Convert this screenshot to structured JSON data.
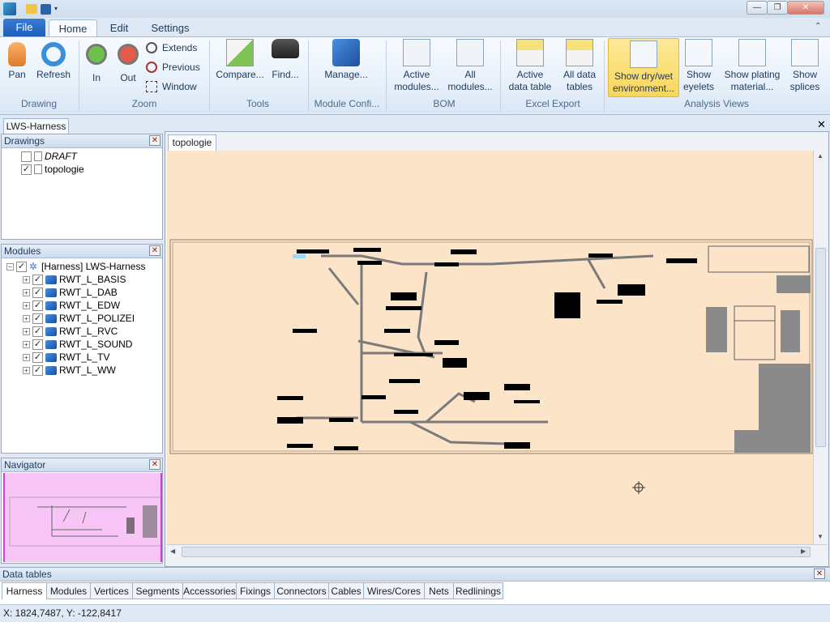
{
  "ribbon": {
    "file": "File",
    "tabs": [
      "Home",
      "Edit",
      "Settings"
    ],
    "drawing": {
      "pan": "Pan",
      "refresh": "Refresh",
      "label": "Drawing"
    },
    "zoom": {
      "in": "In",
      "out": "Out",
      "extends": "Extends",
      "previous": "Previous",
      "window": "Window",
      "label": "Zoom"
    },
    "tools": {
      "compare": "Compare...",
      "find": "Find...",
      "label": "Tools"
    },
    "module": {
      "manage": "Manage...",
      "label": "Module Confi..."
    },
    "bom": {
      "active1": "Active",
      "active2": "modules...",
      "all1": "All",
      "all2": "modules...",
      "label": "BOM"
    },
    "excel": {
      "adt1": "Active",
      "adt2": "data table",
      "all1": "All data",
      "all2": "tables",
      "label": "Excel Export"
    },
    "analysis": {
      "dry1": "Show dry/wet",
      "dry2": "environment...",
      "eye1": "Show",
      "eye2": "eyelets",
      "plat1": "Show plating",
      "plat2": "material...",
      "spl1": "Show",
      "spl2": "splices",
      "label": "Analysis Views"
    }
  },
  "document_tab": "LWS-Harness",
  "drawings": {
    "title": "Drawings",
    "items": [
      "DRAFT",
      "topologie"
    ]
  },
  "modules": {
    "title": "Modules",
    "root": "[Harness] LWS-Harness",
    "items": [
      "RWT_L_BASIS",
      "RWT_L_DAB",
      "RWT_L_EDW",
      "RWT_L_POLIZEI",
      "RWT_L_RVC",
      "RWT_L_SOUND",
      "RWT_L_TV",
      "RWT_L_WW"
    ]
  },
  "navigator": {
    "title": "Navigator"
  },
  "canvas_tab": "topologie",
  "data_tables": {
    "title": "Data tables",
    "tabs": [
      "Harness",
      "Modules",
      "Vertices",
      "Segments",
      "Accessories",
      "Fixings",
      "Connectors",
      "Cables",
      "Wires/Cores",
      "Nets",
      "Redlinings"
    ]
  },
  "status": "X: 1824,7487, Y: -122,8417",
  "colors": {
    "accent": "#1d5fb8",
    "canvas": "#fce4c8",
    "navigator": "#f7c6f7"
  }
}
